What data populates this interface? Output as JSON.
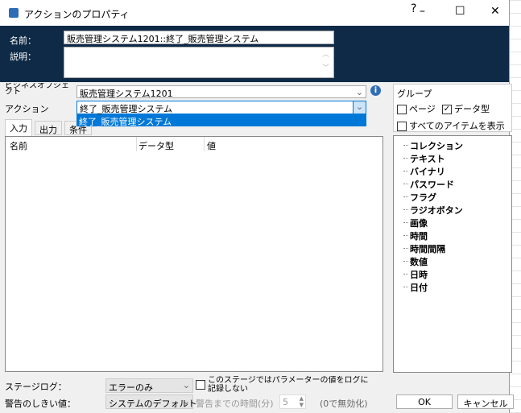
{
  "window": {
    "title": "アクションのプロパティ",
    "help": "?",
    "minimize": "–",
    "maximize": "☐",
    "close": "✕"
  },
  "header": {
    "name_label": "名前：",
    "name_value": "販売管理システム1201::終了_販売管理システム",
    "desc_label": "説明：",
    "desc_value": ""
  },
  "form": {
    "object_label": "ビジネスオブジェクト",
    "object_value": "販売管理システム1201",
    "action_label": "アクション",
    "action_value": "終了_販売管理システム",
    "dropdown_options": [
      "終了_販売管理システム"
    ]
  },
  "tabs": [
    "入力",
    "出力",
    "条件"
  ],
  "grid": {
    "columns": [
      "名前",
      "データ型",
      "値"
    ]
  },
  "group": {
    "title": "グループ",
    "page": "ページ",
    "datatype": "データ型",
    "show_all": "すべてのアイテムを表示",
    "page_checked": false,
    "datatype_checked": true,
    "show_all_checked": false
  },
  "tree": [
    "コレクション",
    "テキスト",
    "バイナリ",
    "パスワード",
    "フラグ",
    "ラジオボタン",
    "画像",
    "時間",
    "時間間隔",
    "数値",
    "日時",
    "日付"
  ],
  "footer": {
    "stage_log_label": "ステージログ：",
    "stage_log_value": "エラーのみ",
    "no_log_label": "このステージではパラメーターの値をログに記録しない",
    "warn_label": "警告のしきい値：",
    "warn_value": "システムのデフォルト",
    "warn_time_label": "警告までの時間(分)",
    "warn_time_value": "5",
    "disabled_hint": "(0で無効化)",
    "ok": "OK",
    "cancel": "キャンセル"
  }
}
